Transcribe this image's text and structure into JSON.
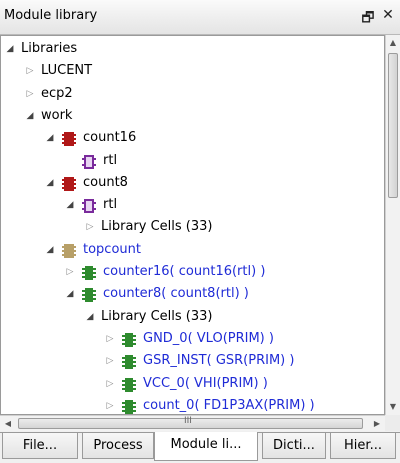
{
  "titlebar": {
    "title": "Module library",
    "float_glyph": "🗗",
    "close_glyph": "✕"
  },
  "colors": {
    "link_blue": "#1f2bd6",
    "module_red": "#b01818",
    "rtl_purple": "#7a2b9c",
    "top_gold": "#b8a068",
    "cell_green": "#2e8b2e"
  },
  "tree": [
    {
      "label": "Libraries",
      "arrow": "expanded",
      "icon": "",
      "color": "black"
    },
    {
      "label": "LUCENT",
      "arrow": "collapsed",
      "icon": "",
      "color": "black"
    },
    {
      "label": "ecp2",
      "arrow": "collapsed",
      "icon": "",
      "color": "black"
    },
    {
      "label": "work",
      "arrow": "expanded",
      "icon": "",
      "color": "black"
    },
    {
      "label": "count16",
      "arrow": "expanded",
      "icon": "module-red-icon",
      "color": "black"
    },
    {
      "label": "rtl",
      "arrow": "",
      "icon": "architecture-purple-icon",
      "color": "black"
    },
    {
      "label": "count8",
      "arrow": "expanded",
      "icon": "module-red-icon",
      "color": "black"
    },
    {
      "label": "rtl",
      "arrow": "expanded",
      "icon": "architecture-purple-icon",
      "color": "black"
    },
    {
      "label": "Library Cells (33)",
      "arrow": "collapsed",
      "icon": "",
      "color": "black"
    },
    {
      "label": "topcount",
      "arrow": "expanded",
      "icon": "module-gold-icon",
      "color": "blue"
    },
    {
      "label": "counter16( count16(rtl) )",
      "arrow": "collapsed",
      "icon": "instance-green-icon",
      "color": "blue"
    },
    {
      "label": "counter8( count8(rtl) )",
      "arrow": "expanded",
      "icon": "instance-green-icon",
      "color": "blue"
    },
    {
      "label": "Library Cells (33)",
      "arrow": "expanded",
      "icon": "",
      "color": "black"
    },
    {
      "label": "GND_0( VLO(PRIM) )",
      "arrow": "collapsed",
      "icon": "instance-green-icon",
      "color": "blue"
    },
    {
      "label": "GSR_INST( GSR(PRIM) )",
      "arrow": "collapsed",
      "icon": "instance-green-icon",
      "color": "blue"
    },
    {
      "label": "VCC_0( VHI(PRIM) )",
      "arrow": "collapsed",
      "icon": "instance-green-icon",
      "color": "blue"
    },
    {
      "label": "count_0( FD1P3AX(PRIM) )",
      "arrow": "collapsed",
      "icon": "instance-green-icon",
      "color": "blue"
    }
  ],
  "hscroll_grip": "III",
  "tabs": [
    {
      "label": "File...",
      "active": false
    },
    {
      "label": "Process",
      "active": false
    },
    {
      "label": "Module li...",
      "active": true
    },
    {
      "label": "Dicti...",
      "active": false
    },
    {
      "label": "Hier...",
      "active": false
    }
  ]
}
